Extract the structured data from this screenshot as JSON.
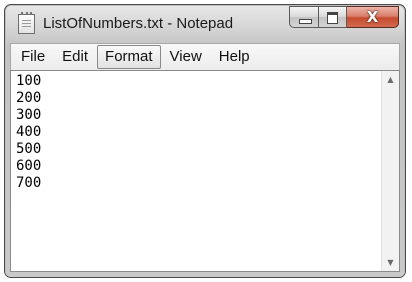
{
  "window": {
    "title": "ListOfNumbers.txt - Notepad",
    "icon": "notepad-icon",
    "buttons": {
      "minimize_icon": "minimize-icon",
      "maximize_icon": "maximize-icon",
      "close_glyph": "X"
    }
  },
  "menubar": {
    "items": [
      {
        "label": "File"
      },
      {
        "label": "Edit"
      },
      {
        "label": "Format",
        "active": true
      },
      {
        "label": "View"
      },
      {
        "label": "Help"
      }
    ]
  },
  "document": {
    "lines": [
      "100",
      "200",
      "300",
      "400",
      "500",
      "600",
      "700"
    ]
  },
  "scrollbar": {
    "up_arrow": "▲",
    "down_arrow": "▼"
  },
  "colors": {
    "close_button": "#c74b2f",
    "chrome": "#cfcfcf",
    "editor_bg": "#ffffff"
  }
}
